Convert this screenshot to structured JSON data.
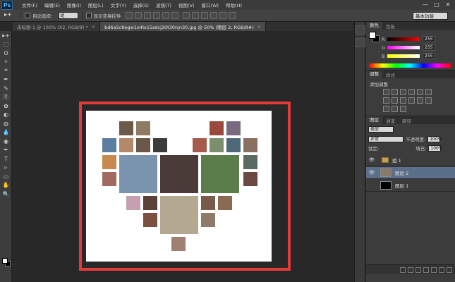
{
  "app": {
    "logo": "Ps"
  },
  "menu": [
    "文件(F)",
    "编辑(E)",
    "图像(I)",
    "图层(L)",
    "文字(Y)",
    "选择(S)",
    "滤镜(T)",
    "视图(V)",
    "窗口(W)",
    "帮助(H)"
  ],
  "window_controls": [
    "—",
    "□",
    "✕"
  ],
  "options": {
    "tool_preset_icon": "move-tool-icon",
    "auto_select_label": "自动选择：",
    "auto_select_value": "组",
    "show_transform_label": "显示变换控件",
    "workspace": "基本功能"
  },
  "tabs": [
    {
      "label": "未标题-1 @ 100% (X2, RGB/8) *",
      "close": "×",
      "active": false
    },
    {
      "label": "bd6a5c8egw1e4lx15sdcj20t30njn30.jpg @ 50% (图层 2, RGB/8#)",
      "close": "×",
      "active": true
    }
  ],
  "tools": [
    "▸+",
    "⬚",
    "ʘ",
    "✧",
    "⌗",
    "✒",
    "✎",
    "⎘",
    "✿",
    "◐",
    "◍",
    "💧",
    "◉",
    "✒",
    "T",
    "▹",
    "▭",
    "✋",
    "🔍"
  ],
  "panels": {
    "color": {
      "tabs": [
        "颜色",
        "色板"
      ],
      "sliders": [
        {
          "name": "R",
          "value": "255",
          "gradient": "linear-gradient(90deg,#000,#ff0000)"
        },
        {
          "name": "G",
          "value": "255",
          "gradient": "linear-gradient(90deg,#ff00ff,#ffffff)"
        },
        {
          "name": "B",
          "value": "255",
          "gradient": "linear-gradient(90deg,#ffff00,#ffffff)"
        }
      ]
    },
    "adjustments": {
      "tabs": [
        "调整",
        "样式"
      ],
      "title": "添加调整"
    },
    "layers": {
      "tabs": [
        "图层",
        "通道",
        "路径"
      ],
      "kind_label": "类型",
      "blend_mode": "正常",
      "opacity_label": "不透明度:",
      "opacity_value": "100%",
      "lock_label": "锁定:",
      "fill_label": "填充:",
      "fill_value": "100%",
      "items": [
        {
          "name": "组 1",
          "type": "group",
          "selected": false
        },
        {
          "name": "图层 2",
          "type": "layer",
          "selected": true
        },
        {
          "name": "图层 1",
          "type": "layer",
          "selected": false
        }
      ]
    }
  },
  "colors": {
    "highlight_border": "#e33a3a",
    "selected_layer": "#5b6f8a",
    "canvas_bg": "#282828"
  }
}
